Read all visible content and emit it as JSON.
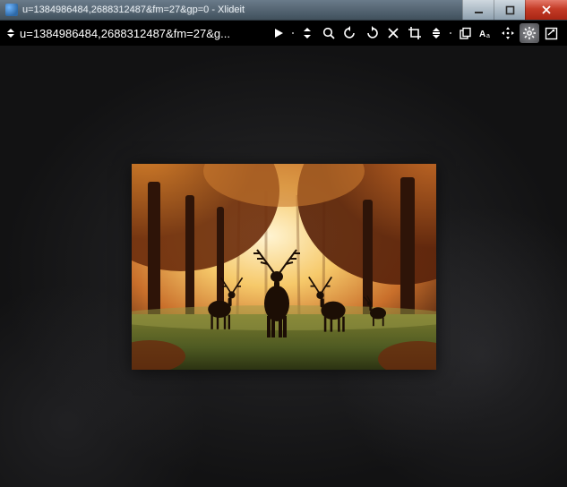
{
  "window": {
    "title": "u=1384986484,2688312487&fm=27&gp=0 - Xlideit"
  },
  "toolbar": {
    "filename": "u=1384986484,2688312487&fm=27&g..."
  },
  "icons": {
    "play": "play",
    "fit": "fit",
    "zoom": "zoom",
    "rotate_ccw": "rotate-ccw",
    "rotate_cw": "rotate-cw",
    "delete": "delete",
    "crop": "crop",
    "levels": "levels",
    "copy": "copy",
    "text": "text",
    "move": "move",
    "settings": "settings",
    "fullscreen": "fullscreen"
  }
}
